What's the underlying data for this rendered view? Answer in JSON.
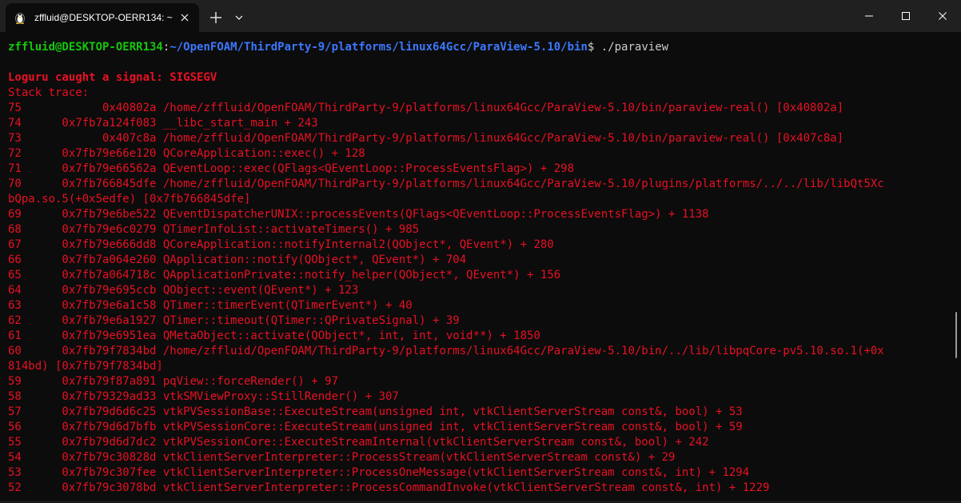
{
  "window": {
    "tab_title": "zffluid@DESKTOP-OERR134: ~",
    "icons": {
      "tab": "linux-penguin-icon",
      "close_tab": "close-icon",
      "new_tab": "plus-icon",
      "dropdown": "chevron-down-icon",
      "minimize": "minimize-icon",
      "maximize": "maximize-icon",
      "close_window": "close-icon"
    }
  },
  "colors": {
    "background": "#0c0c0c",
    "titlebar": "#202020",
    "prompt_user": "#16c60c",
    "prompt_path": "#3b78ff",
    "error_text": "#e81123",
    "default_text": "#cccccc"
  },
  "terminal": {
    "prompt_user": "zffluid@DESKTOP-OERR134",
    "prompt_sep": ":",
    "prompt_path": "~/OpenFOAM/ThirdParty-9/platforms/linux64Gcc/ParaView-5.10/bin",
    "prompt_cmd": "$ ./paraview",
    "signal": "Loguru caught a signal: SIGSEGV",
    "stack_header": "Stack trace:",
    "lines": [
      "75            0x40802a /home/zffluid/OpenFOAM/ThirdParty-9/platforms/linux64Gcc/ParaView-5.10/bin/paraview-real() [0x40802a]",
      "74      0x7fb7a124f083 __libc_start_main + 243",
      "73            0x407c8a /home/zffluid/OpenFOAM/ThirdParty-9/platforms/linux64Gcc/ParaView-5.10/bin/paraview-real() [0x407c8a]",
      "72      0x7fb79e66e120 QCoreApplication::exec() + 128",
      "71      0x7fb79e66562a QEventLoop::exec(QFlags<QEventLoop::ProcessEventsFlag>) + 298",
      "70      0x7fb766845dfe /home/zffluid/OpenFOAM/ThirdParty-9/platforms/linux64Gcc/ParaView-5.10/plugins/platforms/../../lib/libQt5Xc",
      "bQpa.so.5(+0x5edfe) [0x7fb766845dfe]",
      "69      0x7fb79e6be522 QEventDispatcherUNIX::processEvents(QFlags<QEventLoop::ProcessEventsFlag>) + 1138",
      "68      0x7fb79e6c0279 QTimerInfoList::activateTimers() + 985",
      "67      0x7fb79e666dd8 QCoreApplication::notifyInternal2(QObject*, QEvent*) + 280",
      "66      0x7fb7a064e260 QApplication::notify(QObject*, QEvent*) + 704",
      "65      0x7fb7a064718c QApplicationPrivate::notify_helper(QObject*, QEvent*) + 156",
      "64      0x7fb79e695ccb QObject::event(QEvent*) + 123",
      "63      0x7fb79e6a1c58 QTimer::timerEvent(QTimerEvent*) + 40",
      "62      0x7fb79e6a1927 QTimer::timeout(QTimer::QPrivateSignal) + 39",
      "61      0x7fb79e6951ea QMetaObject::activate(QObject*, int, int, void**) + 1850",
      "60      0x7fb79f7834bd /home/zffluid/OpenFOAM/ThirdParty-9/platforms/linux64Gcc/ParaView-5.10/bin/../lib/libpqCore-pv5.10.so.1(+0x",
      "814bd) [0x7fb79f7834bd]",
      "59      0x7fb79f87a891 pqView::forceRender() + 97",
      "58      0x7fb79329ad33 vtkSMViewProxy::StillRender() + 307",
      "57      0x7fb79d6d6c25 vtkPVSessionBase::ExecuteStream(unsigned int, vtkClientServerStream const&, bool) + 53",
      "56      0x7fb79d6d7bfb vtkPVSessionCore::ExecuteStream(unsigned int, vtkClientServerStream const&, bool) + 59",
      "55      0x7fb79d6d7dc2 vtkPVSessionCore::ExecuteStreamInternal(vtkClientServerStream const&, bool) + 242",
      "54      0x7fb79c30828d vtkClientServerInterpreter::ProcessStream(vtkClientServerStream const&) + 29",
      "53      0x7fb79c307fee vtkClientServerInterpreter::ProcessOneMessage(vtkClientServerStream const&, int) + 1294",
      "52      0x7fb79c3078bd vtkClientServerInterpreter::ProcessCommandInvoke(vtkClientServerStream const&, int) + 1229"
    ]
  }
}
